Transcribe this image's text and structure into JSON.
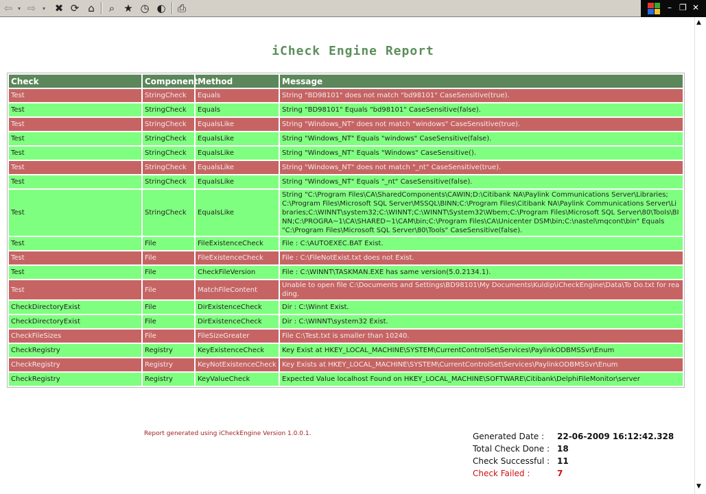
{
  "toolbar": {
    "icons": [
      "back-icon",
      "dropdown-icon",
      "forward-icon",
      "dropdown-icon",
      "stop-icon",
      "refresh-icon",
      "home-icon",
      "search-icon",
      "favorites-icon",
      "history-icon",
      "web-icon",
      "print-icon"
    ],
    "glyphs": {
      "back": "⇦",
      "back_drop": "▾",
      "forward": "⇨",
      "forward_drop": "▾",
      "stop": "✖",
      "refresh": "⟳",
      "home": "⌂",
      "search": "⌕",
      "favorites": "★",
      "history": "◷",
      "web": "◐",
      "print": "⎙"
    }
  },
  "window_controls": {
    "minimize": "–",
    "restore": "❐",
    "close": "✕"
  },
  "scrollbar": {
    "up": "▲",
    "down": "▼"
  },
  "report": {
    "title": "iCheck Engine Report",
    "columns": {
      "check": "Check",
      "component": "Component",
      "method": "Method",
      "message": "Message"
    },
    "rows": [
      {
        "status": "fail",
        "check": "Test",
        "component": "StringCheck",
        "method": "Equals",
        "message": "String \"BD98101\" does not match \"bd98101\" CaseSensitive(true)."
      },
      {
        "status": "pass",
        "check": "Test",
        "component": "StringCheck",
        "method": "Equals",
        "message": "String \"BD98101\" Equals \"bd98101\" CaseSensitive(false)."
      },
      {
        "status": "fail",
        "check": "Test",
        "component": "StringCheck",
        "method": "EqualsLike",
        "message": "String \"Windows_NT\" does not match \"windows\" CaseSensitive(true)."
      },
      {
        "status": "pass",
        "check": "Test",
        "component": "StringCheck",
        "method": "EqualsLike",
        "message": "String \"Windows_NT\" Equals \"windows\" CaseSensitive(false)."
      },
      {
        "status": "pass",
        "check": "Test",
        "component": "StringCheck",
        "method": "EqualsLike",
        "message": "String \"Windows_NT\" Equals \"Windows\" CaseSensitive()."
      },
      {
        "status": "fail",
        "check": "Test",
        "component": "StringCheck",
        "method": "EqualsLike",
        "message": "String \"Windows_NT\" does not match \"_nt\" CaseSensitive(true)."
      },
      {
        "status": "pass",
        "check": "Test",
        "component": "StringCheck",
        "method": "EqualsLike",
        "message": "String \"Windows_NT\" Equals \"_nt\" CaseSensitive(false)."
      },
      {
        "status": "pass",
        "check": "Test",
        "component": "StringCheck",
        "method": "EqualsLike",
        "message": "String \"C:\\Program Files\\CA\\SharedComponents\\CAWIN;D:\\Citibank NA\\Paylink Communications Server\\Libraries;C:\\Program Files\\Microsoft SQL Server\\MSSQL\\BINN;C:\\Program Files\\Citibank NA\\Paylink Communications Server\\Libraries;C:\\WINNT\\system32;C:\\WINNT;C:\\WINNT\\System32\\Wbem;C:\\Program Files\\Microsoft SQL Server\\80\\Tools\\BINN;C:\\PROGRA~1\\CA\\SHARED~1\\CAM\\bin;C:\\Program Files\\CA\\Unicenter DSM\\bin;C:\\nastel\\mqcont\\bin\" Equals \"C:\\Program Files\\Microsoft SQL Server\\80\\Tools\" CaseSensitive(false)."
      },
      {
        "status": "pass",
        "check": "Test",
        "component": "File",
        "method": "FileExistenceCheck",
        "message": "File : C:\\AUTOEXEC.BAT Exist."
      },
      {
        "status": "fail",
        "check": "Test",
        "component": "File",
        "method": "FileExistenceCheck",
        "message": "File : C:\\FileNotExist.txt does not Exist."
      },
      {
        "status": "pass",
        "check": "Test",
        "component": "File",
        "method": "CheckFileVersion",
        "message": "File : C:\\WINNT\\TASKMAN.EXE has same version(5.0.2134.1)."
      },
      {
        "status": "fail",
        "check": "Test",
        "component": "File",
        "method": "MatchFileContent",
        "message": "Unable to open file C:\\Documents and Settings\\BD98101\\My Documents\\Kuldip\\iCheckEngine\\Data\\To Do.txt for reading."
      },
      {
        "status": "pass",
        "check": "CheckDirectoryExist",
        "component": "File",
        "method": "DirExistenceCheck",
        "message": "Dir : C:\\Winnt Exist."
      },
      {
        "status": "pass",
        "check": "CheckDirectoryExist",
        "component": "File",
        "method": "DirExistenceCheck",
        "message": "Dir : C:\\WINNT\\system32 Exist."
      },
      {
        "status": "fail",
        "check": "CheckFileSizes",
        "component": "File",
        "method": "FileSizeGreater",
        "message": "File C:\\Test.txt is smaller than 10240."
      },
      {
        "status": "pass",
        "check": "CheckRegistry",
        "component": "Registry",
        "method": "KeyExistenceCheck",
        "message": "Key Exist at HKEY_LOCAL_MACHINE\\SYSTEM\\CurrentControlSet\\Services\\PaylinkODBMSSvr\\Enum"
      },
      {
        "status": "fail",
        "check": "CheckRegistry",
        "component": "Registry",
        "method": "KeyNotExistenceCheck",
        "message": "Key Exists at HKEY_LOCAL_MACHINE\\SYSTEM\\CurrentControlSet\\Services\\PaylinkODBMSSvr\\Enum"
      },
      {
        "status": "pass",
        "check": "CheckRegistry",
        "component": "Registry",
        "method": "KeyValueCheck",
        "message": "Expected Value localhost Found on HKEY_LOCAL_MACHINE\\SOFTWARE\\Citibank\\DelphiFileMonitor\\server"
      }
    ],
    "colors": {
      "pass_row": "#7fff7f",
      "fail_row": "#c66464",
      "header": "#5b875b",
      "title": "#5a8f5a",
      "failed_text": "#cc1010"
    }
  },
  "footer": {
    "generated_note": "Report generated using iCheckEngine Version 1.0.0.1.",
    "summary": {
      "date_label": "Generated Date :",
      "date_value": "22-06-2009 16:12:42.328",
      "total_label": "Total Check Done :",
      "total_value": "18",
      "success_label": "Check Successful :",
      "success_value": "11",
      "failed_label": "Check Failed :",
      "failed_value": "7"
    }
  }
}
